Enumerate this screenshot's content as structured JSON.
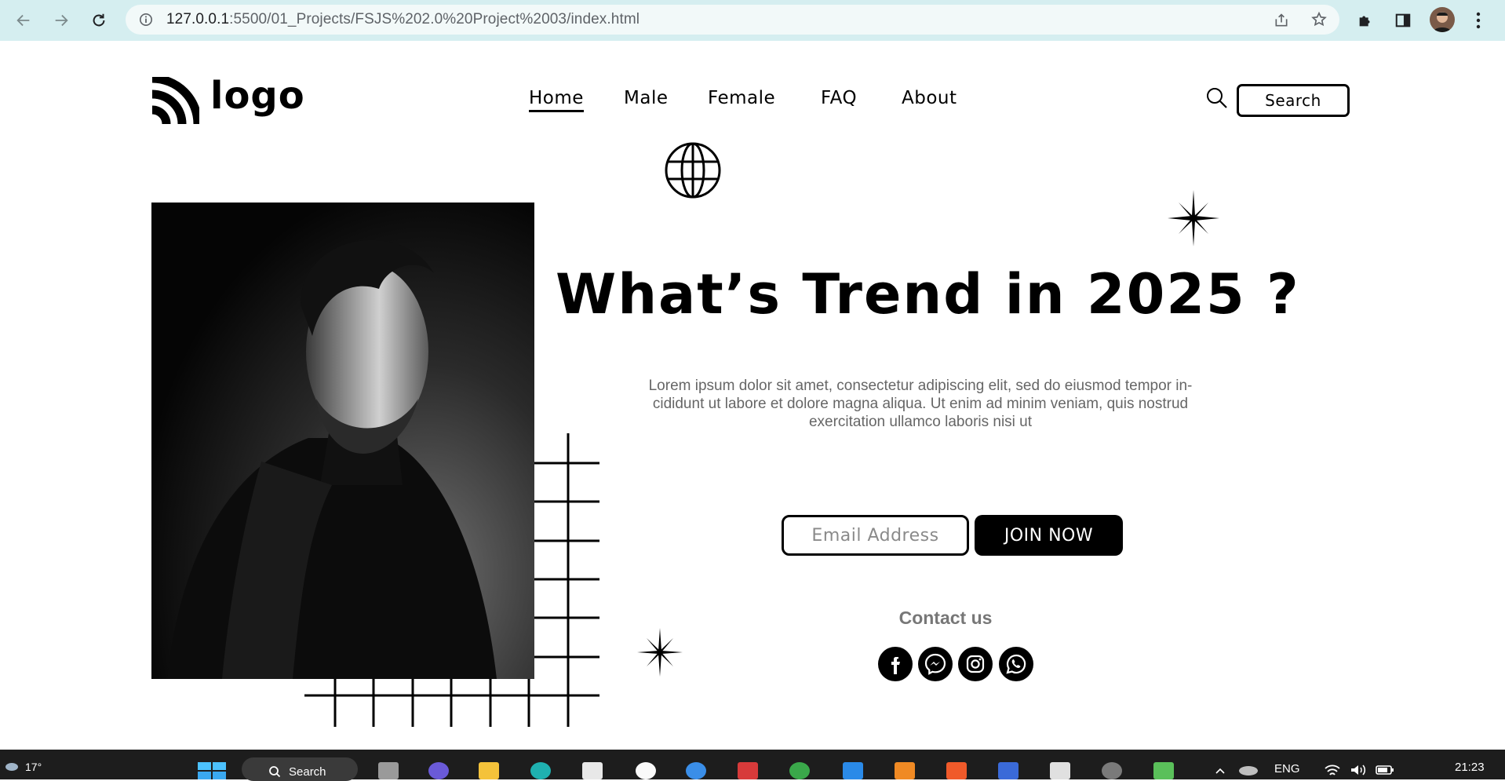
{
  "browser": {
    "url_host": "127.0.0.1",
    "url_path": ":5500/01_Projects/FSJS%202.0%20Project%2003/index.html"
  },
  "site": {
    "logo_text": "logo",
    "nav": [
      "Home",
      "Male",
      "Female",
      "FAQ",
      "About"
    ],
    "active_nav": "Home",
    "search_label": "Search",
    "headline": "What’s Trend in 2025 ?",
    "paragraph": "Lorem ipsum dolor sit amet, consectetur adipiscing elit, sed do eiusmod tempor in- cididunt ut labore et dolore magna aliqua. Ut enim ad minim veniam, quis nostrud exercitation ullamco laboris nisi ut",
    "email_placeholder": "Email Address",
    "join_label": "JOIN NOW",
    "contact_label": "Contact us",
    "socials": [
      "facebook-icon",
      "messenger-icon",
      "instagram-icon",
      "whatsapp-icon"
    ]
  },
  "taskbar": {
    "weather": "17°",
    "search_label": "Search",
    "language": "ENG",
    "time": "21:23"
  },
  "colors": {
    "chrome_bg": "#d5eef0",
    "accent": "#000000",
    "taskbar": "#1d1d1d"
  }
}
